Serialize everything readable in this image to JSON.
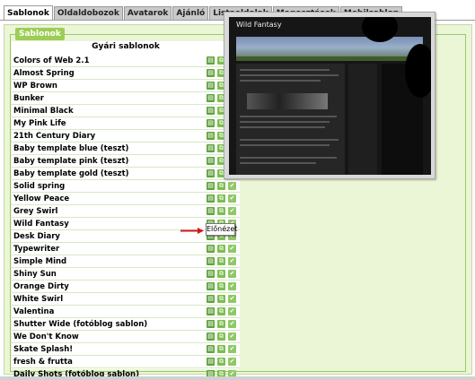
{
  "tabs": [
    {
      "label": "Sablonok",
      "active": true
    },
    {
      "label": "Oldaldobozok"
    },
    {
      "label": "Avatarok"
    },
    {
      "label": "Ajánló"
    },
    {
      "label": "Listaoldalak"
    },
    {
      "label": "Megosztások"
    },
    {
      "label": "Mobilsablon"
    }
  ],
  "section": {
    "legend": "Sablonok",
    "list_title": "Gyári sablonok"
  },
  "templates": [
    "Colors of Web 2.1",
    "Almost Spring",
    "WP Brown",
    "Bunker",
    "Minimal Black",
    "My Pink Life",
    "21th Century Diary",
    "Baby template blue (teszt)",
    "Baby template pink (teszt)",
    "Baby template gold (teszt)",
    "Solid spring",
    "Yellow Peace",
    "Grey Swirl",
    "Wild Fantasy",
    "Desk Diary",
    "Typewriter",
    "Simple Mind",
    "Shiny Sun",
    "Orange Dirty",
    "White Swirl",
    "Valentina",
    "Shutter Wide (fotóblog sablon)",
    "We Don't Know",
    "Skate Splash!",
    "fresh & frutta",
    "Daily Shots (fotóblog sablon)"
  ],
  "preview": {
    "site_title": "Wild Fantasy"
  },
  "tooltip": {
    "label": "Előnézet"
  },
  "colors": {
    "accent": "#9ccd57",
    "panel_bg": "#eaf6d6",
    "arrow": "#d01818"
  },
  "icons": {
    "preview": "preview-icon",
    "copy": "copy-icon",
    "select": "check-icon"
  }
}
